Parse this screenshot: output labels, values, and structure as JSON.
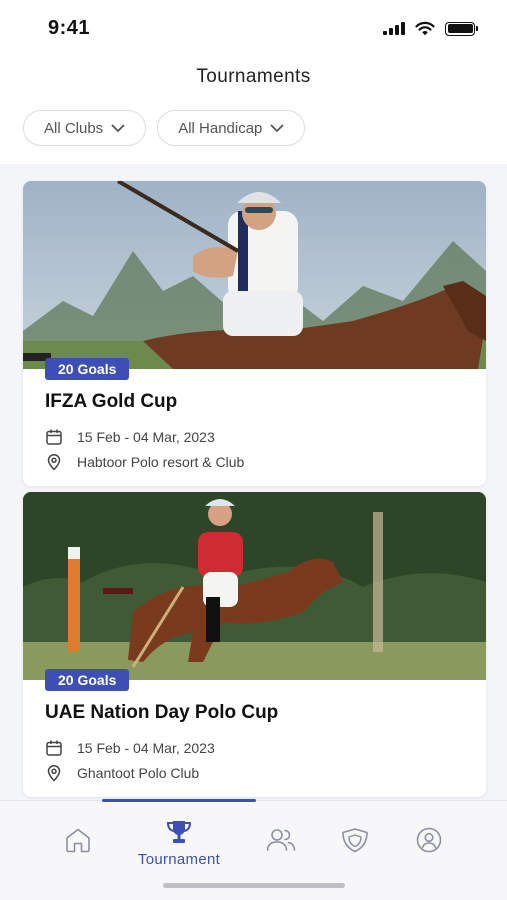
{
  "status_bar": {
    "time": "9:41"
  },
  "header": {
    "title": "Tournaments"
  },
  "filters": [
    {
      "label": "All Clubs"
    },
    {
      "label": "All Handicap"
    }
  ],
  "tournaments": [
    {
      "badge": "20 Goals",
      "title": "IFZA Gold Cup",
      "dates": "15 Feb -  04 Mar, 2023",
      "venue": "Habtoor Polo resort & Club"
    },
    {
      "badge": "20 Goals",
      "title": "UAE Nation Day Polo Cup",
      "dates": "15 Feb -  04 Mar, 2023",
      "venue": "Ghantoot Polo Club"
    }
  ],
  "bottom_nav": {
    "active_label": "Tournament",
    "items": [
      "home-icon",
      "trophy-icon",
      "users-icon",
      "shield-icon",
      "profile-icon"
    ]
  },
  "colors": {
    "accent": "#3d4fb5",
    "background": "#f4f5f8"
  }
}
